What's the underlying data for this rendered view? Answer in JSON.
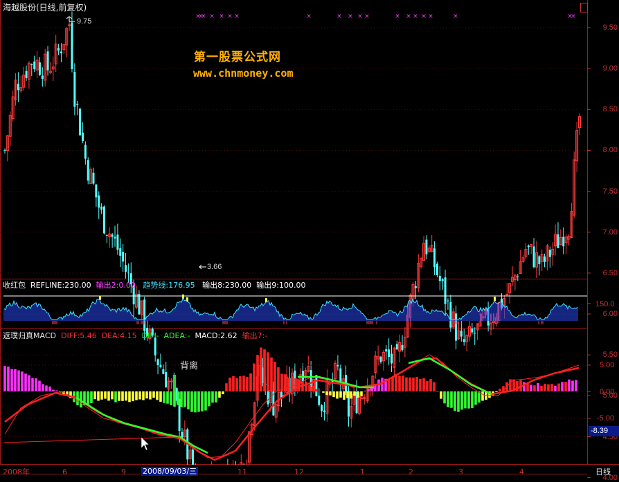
{
  "main_panel": {
    "title": "海越股份(日线,前复权)",
    "high_annotation": "9.75",
    "low_annotation": "3.66",
    "y_ticks": [
      "9.50",
      "9.00",
      "8.50",
      "8.00",
      "7.50",
      "7.00",
      "6.50",
      "6.00",
      "5.50",
      "5.00",
      "4.50",
      "4.00"
    ]
  },
  "watermark": {
    "line1": "第一股票公式网",
    "line2": "www.chnmoney.com"
  },
  "indicator_panel": {
    "name": "收红包",
    "refline": "REFLINE:230.00",
    "out2": "输出2:0.00",
    "trend": "趋势线:176.95",
    "out8": "输出8:230.00",
    "out9": "输出9:100.00",
    "y_tick": "150.0",
    "colors": {
      "refline": "#ffffff",
      "out2": "#ff40ff",
      "trend": "#40e0ff",
      "out8": "#ffffff",
      "out9": "#ffffff"
    }
  },
  "macd_panel": {
    "name": "返璞归真MACD",
    "diff": "DIFF:5.46",
    "dea": "DEA:4.15",
    "dif": "DIF:-",
    "adea": "ADEA:-",
    "macd": "MACD:2.62",
    "out7": "输出7:-",
    "annotation": "背离",
    "y_ticks": [
      "5.00",
      "0.00",
      "-5.00"
    ],
    "cursor_readout": "-8.39",
    "colors": {
      "diff": "#ff3030",
      "dea": "#ff3030",
      "dif": "#30ff30",
      "adea": "#30ff30",
      "macd": "#ffffff",
      "out7": "#ff3030"
    }
  },
  "timeline": {
    "labels": [
      "2008年",
      "6",
      "9",
      "2008/09/03/三",
      "11",
      "12",
      "1",
      "2",
      "3",
      "4"
    ],
    "period_button": "日线"
  },
  "chart_data": {
    "type": "candlestick",
    "title": "海越股份(日线,前复权)",
    "ylim": [
      3.4,
      9.9
    ],
    "annotated_high": 9.75,
    "annotated_low": 3.66,
    "close_path": [
      {
        "t": 0,
        "v": 8.0
      },
      {
        "t": 4,
        "v": 8.8
      },
      {
        "t": 10,
        "v": 9.1
      },
      {
        "t": 16,
        "v": 9.0
      },
      {
        "t": 20,
        "v": 9.2
      },
      {
        "t": 24,
        "v": 9.55
      },
      {
        "t": 26,
        "v": 8.7
      },
      {
        "t": 30,
        "v": 7.9
      },
      {
        "t": 36,
        "v": 7.2
      },
      {
        "t": 42,
        "v": 6.8
      },
      {
        "t": 50,
        "v": 6.1
      },
      {
        "t": 56,
        "v": 5.5
      },
      {
        "t": 62,
        "v": 5.1
      },
      {
        "t": 68,
        "v": 4.3
      },
      {
        "t": 72,
        "v": 3.8
      },
      {
        "t": 78,
        "v": 4.05
      },
      {
        "t": 86,
        "v": 4.0
      },
      {
        "t": 90,
        "v": 4.3
      },
      {
        "t": 94,
        "v": 5.3
      },
      {
        "t": 100,
        "v": 4.9
      },
      {
        "t": 106,
        "v": 5.1
      },
      {
        "t": 112,
        "v": 5.4
      },
      {
        "t": 118,
        "v": 4.9
      },
      {
        "t": 124,
        "v": 5.3
      },
      {
        "t": 128,
        "v": 4.8
      },
      {
        "t": 134,
        "v": 5.1
      },
      {
        "t": 140,
        "v": 5.5
      },
      {
        "t": 146,
        "v": 5.4
      },
      {
        "t": 150,
        "v": 6.0
      },
      {
        "t": 156,
        "v": 6.9
      },
      {
        "t": 160,
        "v": 6.6
      },
      {
        "t": 164,
        "v": 6.2
      },
      {
        "t": 170,
        "v": 5.6
      },
      {
        "t": 176,
        "v": 5.8
      },
      {
        "t": 182,
        "v": 6.0
      },
      {
        "t": 188,
        "v": 6.3
      },
      {
        "t": 194,
        "v": 6.8
      },
      {
        "t": 200,
        "v": 6.6
      },
      {
        "t": 206,
        "v": 6.9
      },
      {
        "t": 210,
        "v": 7.1
      },
      {
        "t": 214,
        "v": 8.4
      }
    ]
  }
}
